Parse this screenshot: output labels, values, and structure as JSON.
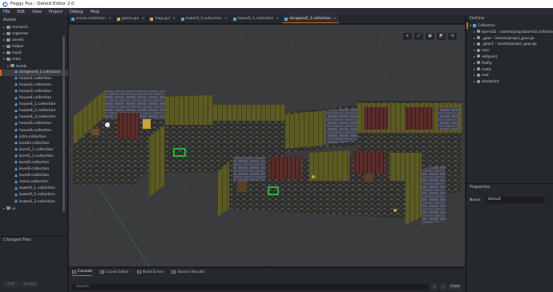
{
  "window": {
    "title": "Foggy Fox - Defold Editor 2.0"
  },
  "menu": [
    "File",
    "Edit",
    "View",
    "Project",
    "Debug",
    "Help"
  ],
  "assets": {
    "header": "Assets",
    "items": [
      {
        "label": "monarch",
        "type": "folder",
        "depth": 1,
        "arrow": "▸"
      },
      {
        "label": "orgames",
        "type": "folder",
        "depth": 1,
        "arrow": "▸"
      },
      {
        "label": "assets",
        "type": "folder",
        "depth": 1,
        "arrow": "▸"
      },
      {
        "label": "helper",
        "type": "folder",
        "depth": 1,
        "arrow": "▸"
      },
      {
        "label": "input",
        "type": "folder",
        "depth": 1,
        "arrow": "▸"
      },
      {
        "label": "main",
        "type": "folder",
        "depth": 1,
        "arrow": "▾"
      },
      {
        "label": "levels",
        "type": "folder",
        "depth": 2,
        "arrow": "▾"
      },
      {
        "label": "dungeon0_1.collection",
        "type": "coll",
        "depth": 3,
        "selected": true
      },
      {
        "label": "house1.collection",
        "type": "coll",
        "depth": 3
      },
      {
        "label": "house2.collection",
        "type": "coll",
        "depth": 3
      },
      {
        "label": "house3.collection",
        "type": "coll",
        "depth": 3
      },
      {
        "label": "house4.collection",
        "type": "coll",
        "depth": 3
      },
      {
        "label": "house4_1.collection",
        "type": "coll",
        "depth": 3
      },
      {
        "label": "house4_2.collection",
        "type": "coll",
        "depth": 3
      },
      {
        "label": "house4_3.collection",
        "type": "coll",
        "depth": 3
      },
      {
        "label": "house5.collection",
        "type": "coll",
        "depth": 3
      },
      {
        "label": "house6.collection",
        "type": "coll",
        "depth": 3
      },
      {
        "label": "intro.collection",
        "type": "coll",
        "depth": 3
      },
      {
        "label": "level0.collection",
        "type": "coll",
        "depth": 3
      },
      {
        "label": "level1_1.collection",
        "type": "coll",
        "depth": 3
      },
      {
        "label": "level1_2.collection",
        "type": "coll",
        "depth": 3
      },
      {
        "label": "level2.collection",
        "type": "coll",
        "depth": 3
      },
      {
        "label": "level3.collection",
        "type": "coll",
        "depth": 3
      },
      {
        "label": "level4.collection",
        "type": "coll",
        "depth": 3
      },
      {
        "label": "menu.collection",
        "type": "coll",
        "depth": 3
      },
      {
        "label": "tower0_1.collection",
        "type": "coll",
        "depth": 3
      },
      {
        "label": "tower0_2.collection",
        "type": "coll",
        "depth": 3
      },
      {
        "label": "tower0_3.collection",
        "type": "coll",
        "depth": 3
      },
      {
        "label": "ui",
        "type": "folder",
        "depth": 1,
        "arrow": "▸"
      }
    ]
  },
  "changed_files": {
    "header": "Changed Files",
    "diff": "Diff",
    "revert": "Revert"
  },
  "tabs": [
    {
      "label": "scene.collection",
      "active": false
    },
    {
      "label": "game.gui",
      "active": false
    },
    {
      "label": "map.gui",
      "active": false
    },
    {
      "label": "tower0_3.collection",
      "active": false
    },
    {
      "label": "tower0_1.collection",
      "active": false
    },
    {
      "label": "dungeon0_1.collection",
      "active": true
    }
  ],
  "viewport_tools": [
    "+",
    "⤢",
    "▣",
    "◩",
    "⟲"
  ],
  "bottom": {
    "tabs": [
      {
        "label": "Console",
        "active": true
      },
      {
        "label": "Curve Editor",
        "active": false
      },
      {
        "label": "Build Errors",
        "active": false
      },
      {
        "label": "Search Results",
        "active": false
      }
    ],
    "search_placeholder": "Search",
    "clear": "Clear"
  },
  "outline": {
    "header": "Outline",
    "rows": [
      {
        "label": "Collection",
        "depth": 0,
        "arrow": "▾",
        "top": true
      },
      {
        "label": "barrel22 - /assets/props/barrel2.collection",
        "depth": 1,
        "arrow": "▸"
      },
      {
        "label": "_gear - /assets/props/_gear.go",
        "depth": 1,
        "arrow": "▸"
      },
      {
        "label": "_gear1 - /assets/props/_gear.go",
        "depth": 1,
        "arrow": "▸"
      },
      {
        "label": "cam",
        "depth": 1,
        "arrow": "▸"
      },
      {
        "label": "exitpoint",
        "depth": 1,
        "arrow": "▸"
      },
      {
        "label": "firefly",
        "depth": 1,
        "arrow": "▸"
      },
      {
        "label": "mobs",
        "depth": 1,
        "arrow": "▸"
      },
      {
        "label": "root",
        "depth": 1,
        "arrow": "▸"
      },
      {
        "label": "startpoint",
        "depth": 1,
        "arrow": "▸"
      }
    ]
  },
  "properties": {
    "header": "Properties",
    "name_label": "Name",
    "name_value": "default"
  },
  "colors": {
    "accent": "#d9631e",
    "collection_icon": "#5a9bd8",
    "wood": "#6b6a2a",
    "floor": "#2e2f2c"
  }
}
